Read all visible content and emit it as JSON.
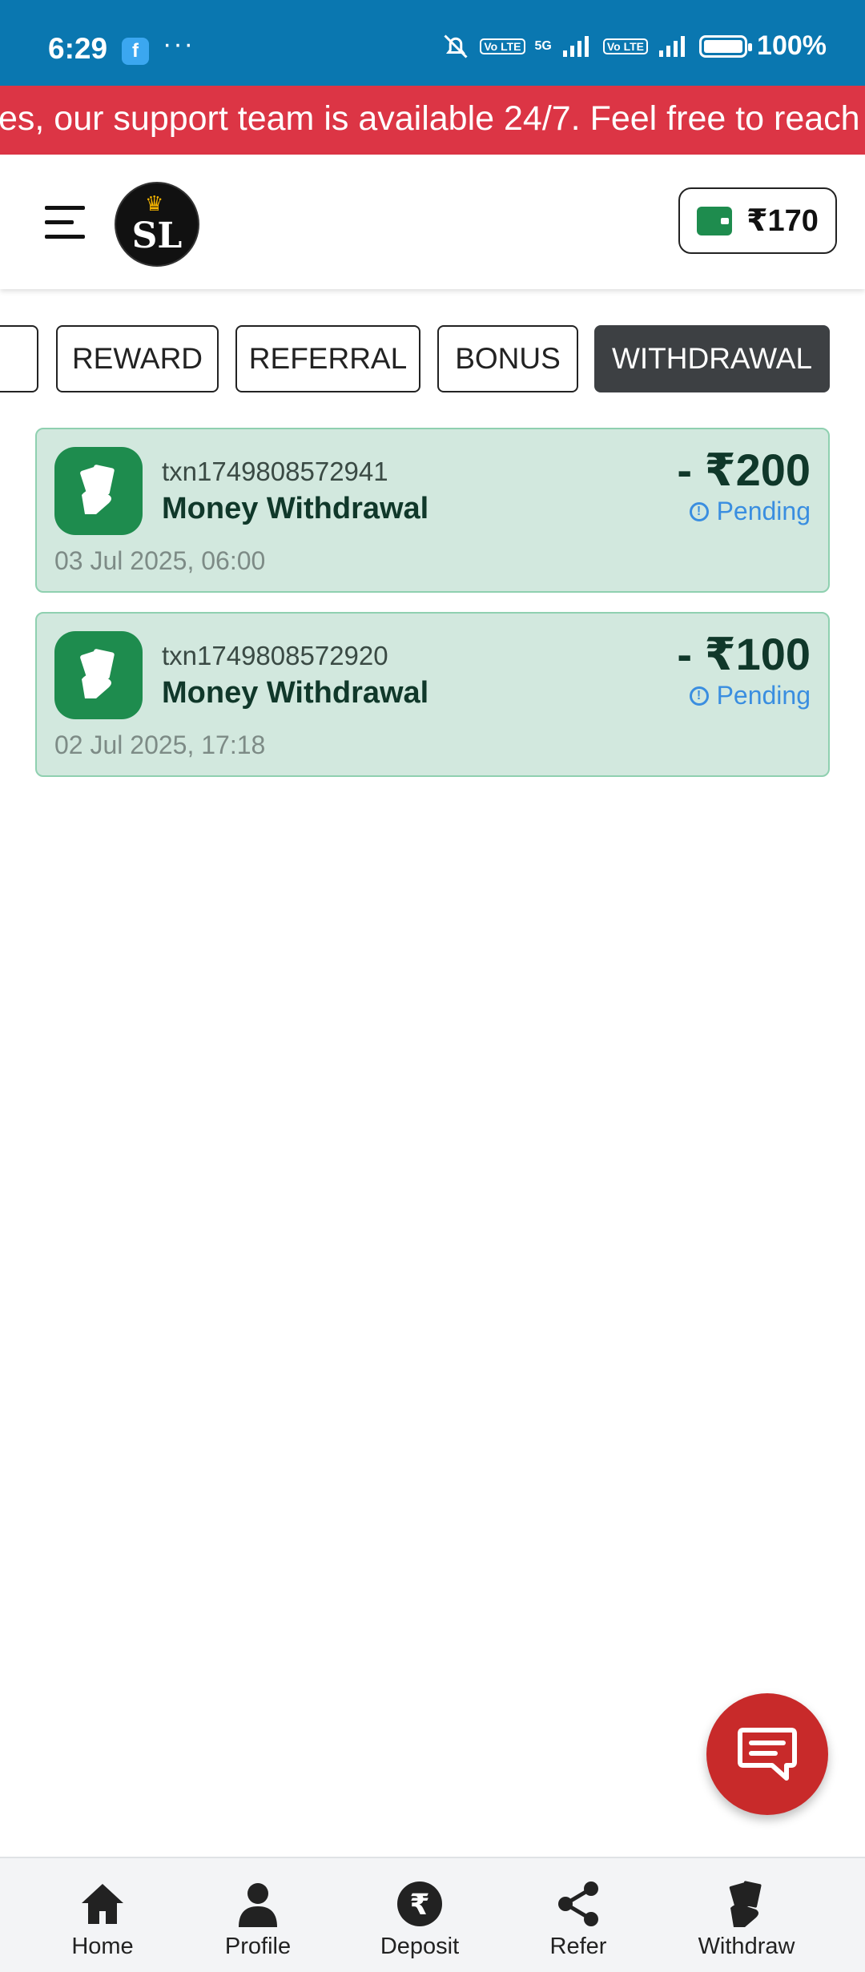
{
  "status_bar": {
    "time": "6:29",
    "fb_icon": "f",
    "dots": "···",
    "volte1": "Vo LTE",
    "network": "5G",
    "volte2": "Vo LTE",
    "battery": "100%"
  },
  "marquee": {
    "text": "es, our support team is available 24/7. Feel free to reach"
  },
  "header": {
    "logo_text": "SL",
    "wallet_amount": "₹170"
  },
  "tabs": [
    {
      "label": "REWARD"
    },
    {
      "label": "REFERRAL"
    },
    {
      "label": "BONUS"
    },
    {
      "label": "WITHDRAWAL",
      "active": true
    }
  ],
  "transactions": [
    {
      "id": "txn1749808572941",
      "title": "Money Withdrawal",
      "date": "03 Jul 2025, 06:00",
      "amount": "- ₹200",
      "status": "Pending"
    },
    {
      "id": "txn1749808572920",
      "title": "Money Withdrawal",
      "date": "02 Jul 2025, 17:18",
      "amount": "- ₹100",
      "status": "Pending"
    }
  ],
  "bottom_nav": [
    {
      "label": "Home",
      "icon": "home-icon"
    },
    {
      "label": "Profile",
      "icon": "person-icon"
    },
    {
      "label": "Deposit",
      "icon": "rupee-icon"
    },
    {
      "label": "Refer",
      "icon": "share-icon"
    },
    {
      "label": "Withdraw",
      "icon": "cash-icon"
    }
  ],
  "colors": {
    "status_bar": "#0a77b0",
    "marquee": "#dc3545",
    "accent_green": "#1e8c4e",
    "card_bg": "#d2e8de",
    "pending": "#3a8ee0",
    "fab": "#c82a2a"
  }
}
